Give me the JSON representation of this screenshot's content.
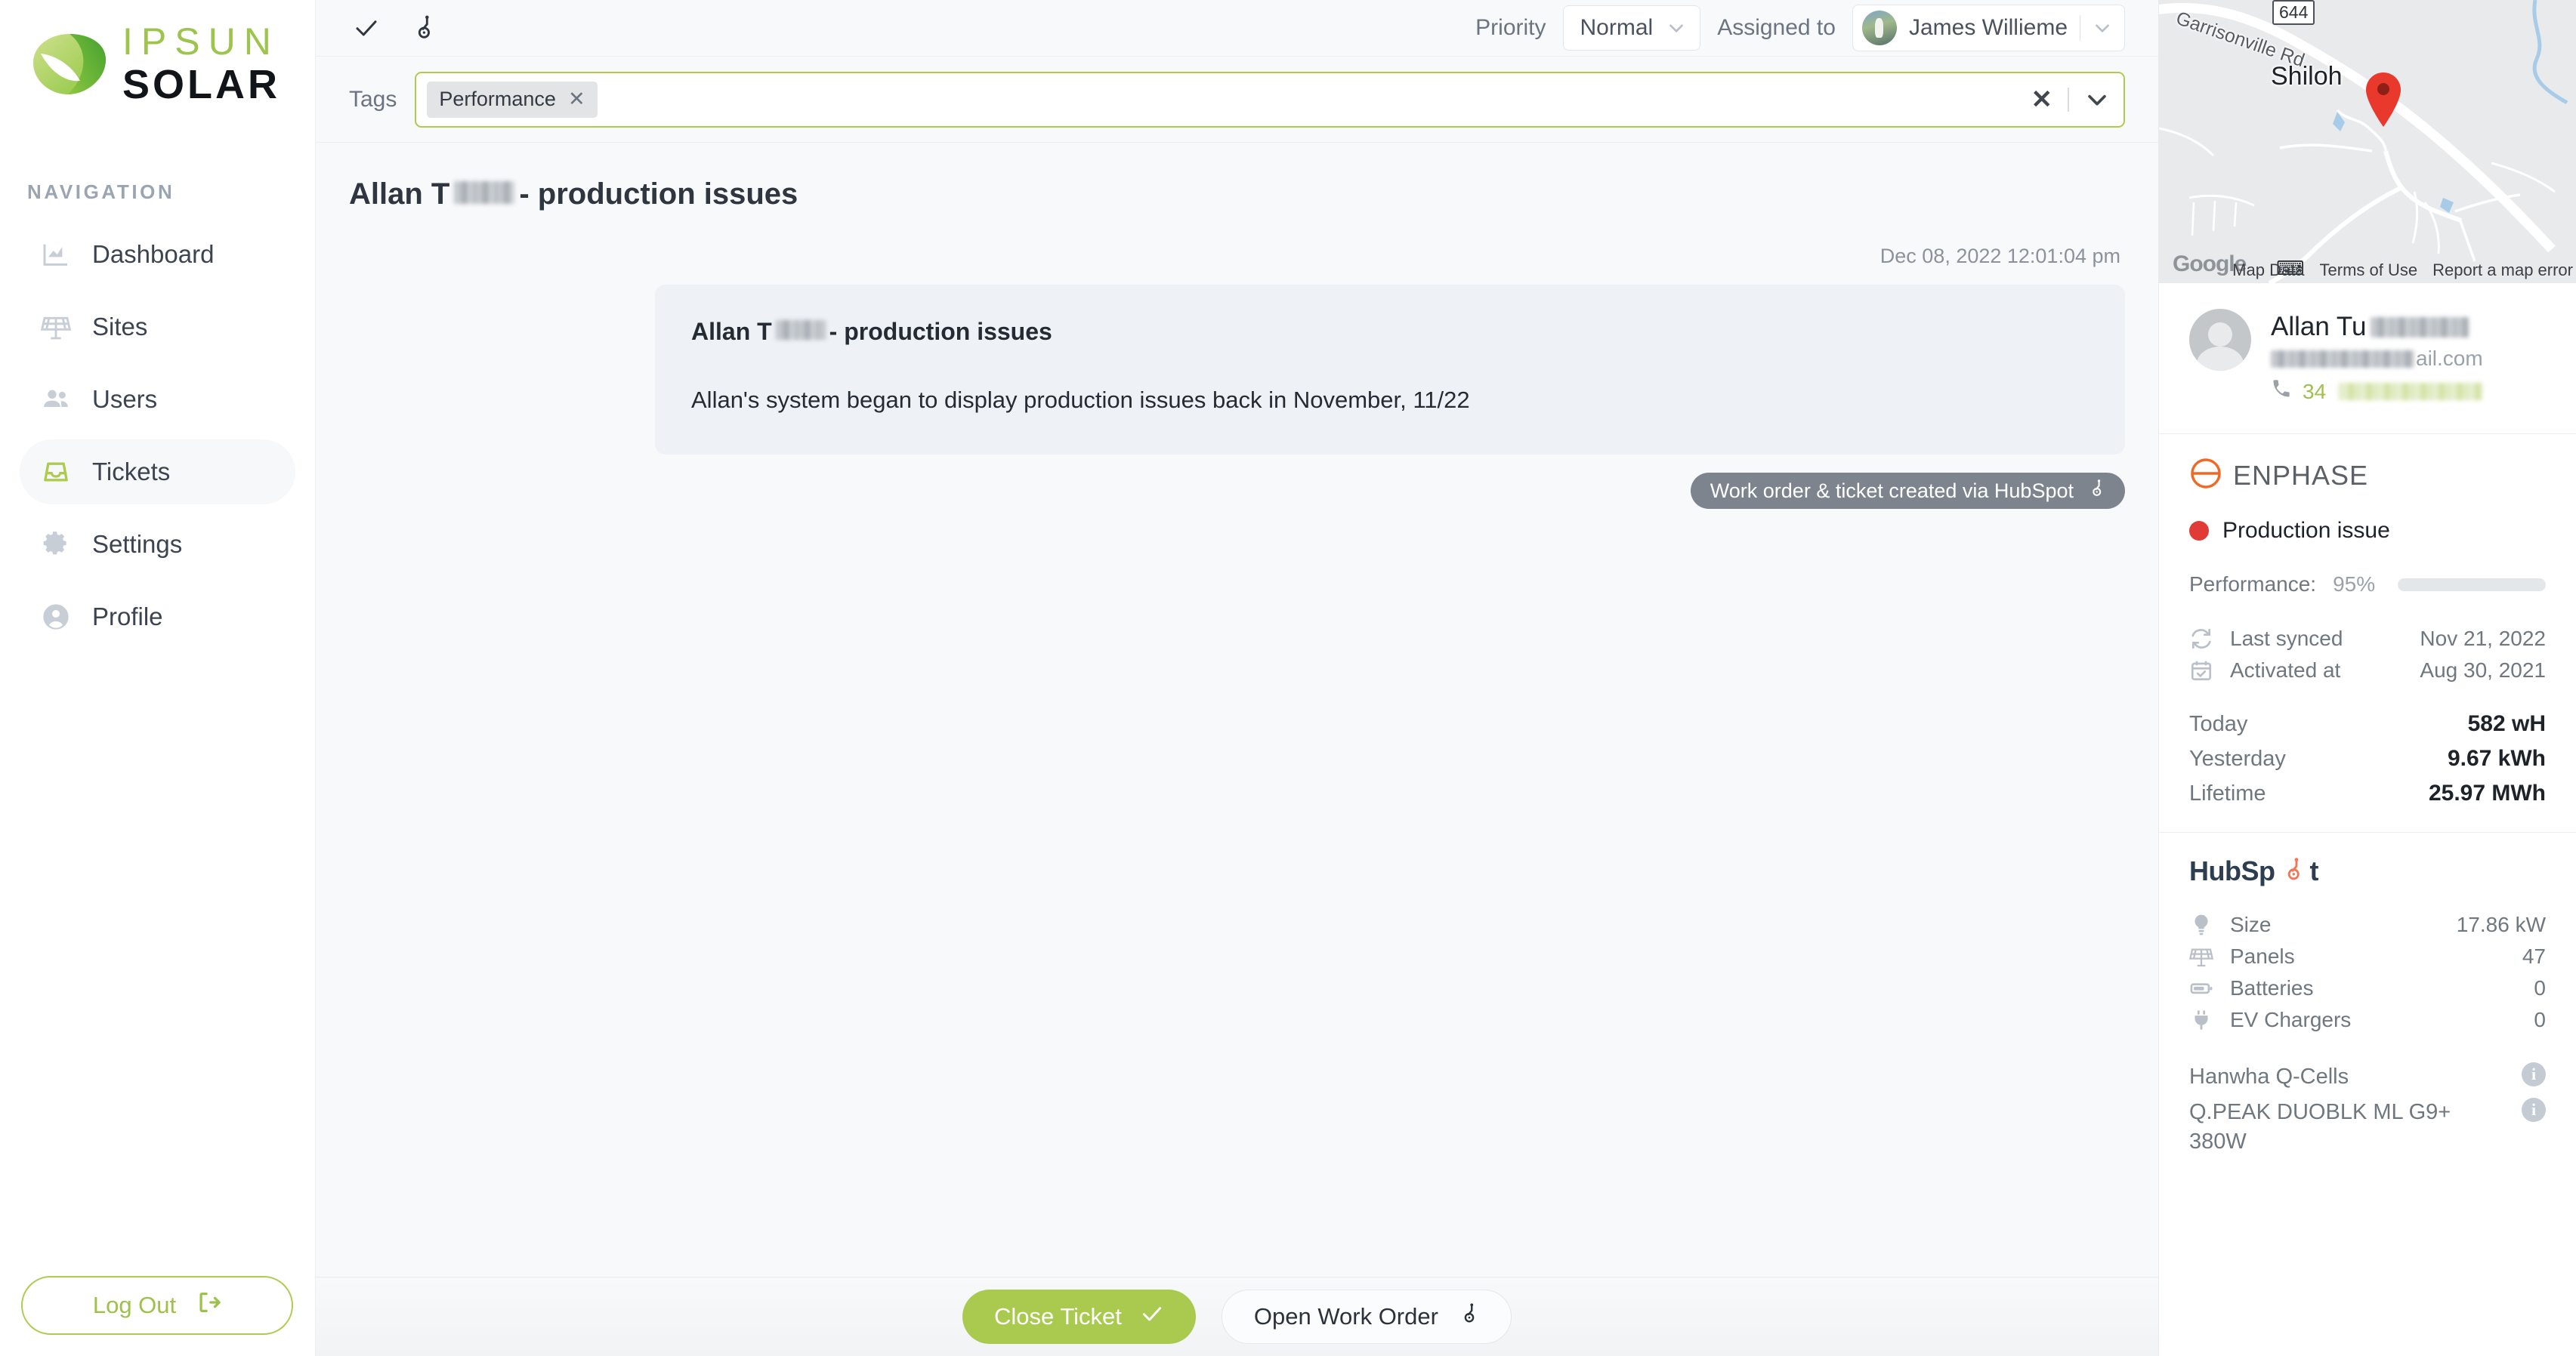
{
  "brand": {
    "name_top": "IPSUN",
    "name_bottom": "SOLAR",
    "accent": "#aecb4f",
    "logo_icon": "leaf-logo-icon"
  },
  "sidebar": {
    "section_label": "NAVIGATION",
    "items": [
      {
        "label": "Dashboard",
        "icon": "chart-area-icon",
        "active": false
      },
      {
        "label": "Sites",
        "icon": "solar-panel-icon",
        "active": false
      },
      {
        "label": "Users",
        "icon": "users-icon",
        "active": false
      },
      {
        "label": "Tickets",
        "icon": "inbox-icon",
        "active": true
      },
      {
        "label": "Settings",
        "icon": "gear-icon",
        "active": false
      },
      {
        "label": "Profile",
        "icon": "user-circle-icon",
        "active": false
      }
    ],
    "logout_label": "Log Out",
    "logout_icon": "sign-out-icon"
  },
  "topbar": {
    "resolve_icon": "check-icon",
    "hubspot_icon": "hubspot-sprocket-icon",
    "priority_label": "Priority",
    "priority_value": "Normal",
    "assigned_label": "Assigned to",
    "assignee_name": "James Willieme",
    "assignee_avatar": "avatar"
  },
  "tags": {
    "label": "Tags",
    "chips": [
      {
        "label": "Performance",
        "remove_icon": "x-icon"
      }
    ],
    "clear_icon": "clear-x-icon",
    "dropdown_icon": "chevron-down-icon"
  },
  "ticket": {
    "title_prefix": "Allan T",
    "title_suffix": "- production issues",
    "redacted_note": "last name redacted"
  },
  "thread": {
    "timestamp": "Dec 08, 2022 12:01:04 pm",
    "message": {
      "heading_prefix": "Allan T",
      "heading_suffix": "- production issues",
      "body": "Allan's system began to display production issues back in November, 11/22"
    },
    "badge": {
      "label": "Work order & ticket created via HubSpot",
      "icon": "hubspot-sprocket-icon"
    }
  },
  "footer": {
    "close_ticket_label": "Close Ticket",
    "close_ticket_icon": "check-icon",
    "open_work_order_label": "Open Work Order",
    "open_work_order_icon": "hubspot-sprocket-icon"
  },
  "map": {
    "road_label": "Garrisonville Rd",
    "route_shield": "644",
    "city_label": "Shiloh",
    "provider": "Google",
    "keyboard_icon": "keyboard-icon",
    "pin_icon": "map-pin-icon",
    "credits": [
      "Map Data",
      "Terms of Use",
      "Report a map error"
    ]
  },
  "contact": {
    "name_prefix": "Allan Tu",
    "email_suffix": "ail.com",
    "phone_prefix": "34",
    "phone_icon": "phone-icon",
    "avatar_icon": "avatar-placeholder-icon"
  },
  "enphase": {
    "logo_word": "ENPHASE",
    "logo_icon": "enphase-e-icon",
    "status_label": "Production issue",
    "status_color": "#e03b36",
    "performance_label": "Performance:",
    "performance_value": "95%",
    "performance_pct": 95,
    "meta": [
      {
        "icon": "sync-icon",
        "key": "Last synced",
        "value": "Nov 21, 2022"
      },
      {
        "icon": "calendar-check-icon",
        "key": "Activated at",
        "value": "Aug 30, 2021"
      }
    ],
    "production": [
      {
        "key": "Today",
        "value": "582 wH"
      },
      {
        "key": "Yesterday",
        "value": "9.67 kWh"
      },
      {
        "key": "Lifetime",
        "value": "25.97 MWh"
      }
    ]
  },
  "hubspot": {
    "logo_word": "HubSp",
    "logo_word_tail": "t",
    "logo_icon": "hubspot-sprocket-icon",
    "specs": [
      {
        "icon": "bulb-icon",
        "key": "Size",
        "value": "17.86 kW"
      },
      {
        "icon": "solar-panel-icon",
        "key": "Panels",
        "value": "47"
      },
      {
        "icon": "battery-icon",
        "key": "Batteries",
        "value": "0"
      },
      {
        "icon": "ev-plug-icon",
        "key": "EV Chargers",
        "value": "0"
      }
    ],
    "equipment": [
      {
        "text": "Hanwha Q-Cells",
        "info_icon": "info-icon"
      },
      {
        "text": "Q.PEAK DUOBLK ML G9+ 380W",
        "info_icon": "info-icon"
      }
    ]
  }
}
